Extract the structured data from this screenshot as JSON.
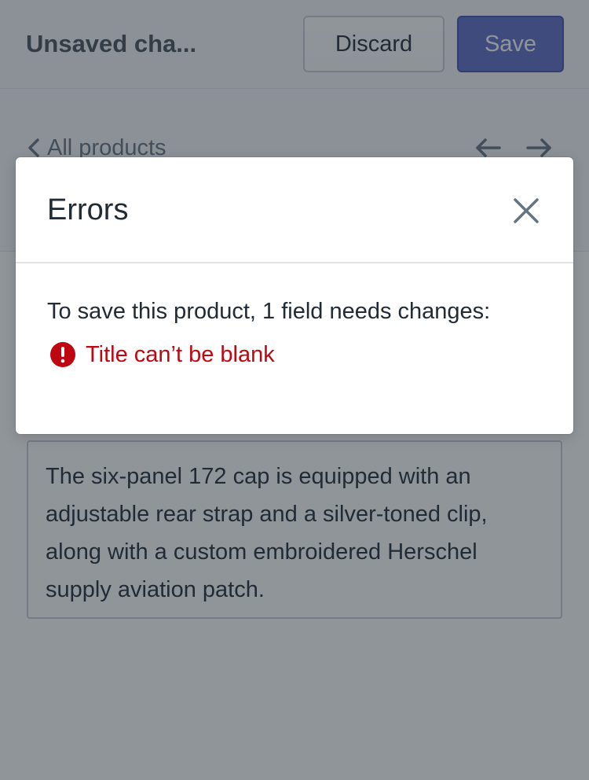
{
  "topbar": {
    "title": "Unsaved cha...",
    "discard_label": "Discard",
    "save_label": "Save"
  },
  "breadcrumb": {
    "label": "All products"
  },
  "product": {
    "description": "The six-panel 172 cap is equipped with an adjustable rear strap and a silver-toned clip, along with a custom embroidered Herschel supply aviation patch."
  },
  "modal": {
    "title": "Errors",
    "message": "To save this product, 1 field needs changes:",
    "errors": [
      {
        "text": "Title can’t be blank",
        "icon": "alert-circle-icon"
      }
    ]
  },
  "colors": {
    "primary": "#5c6ac4",
    "error": "#bf0711",
    "text": "#212b36",
    "muted": "#637381"
  }
}
